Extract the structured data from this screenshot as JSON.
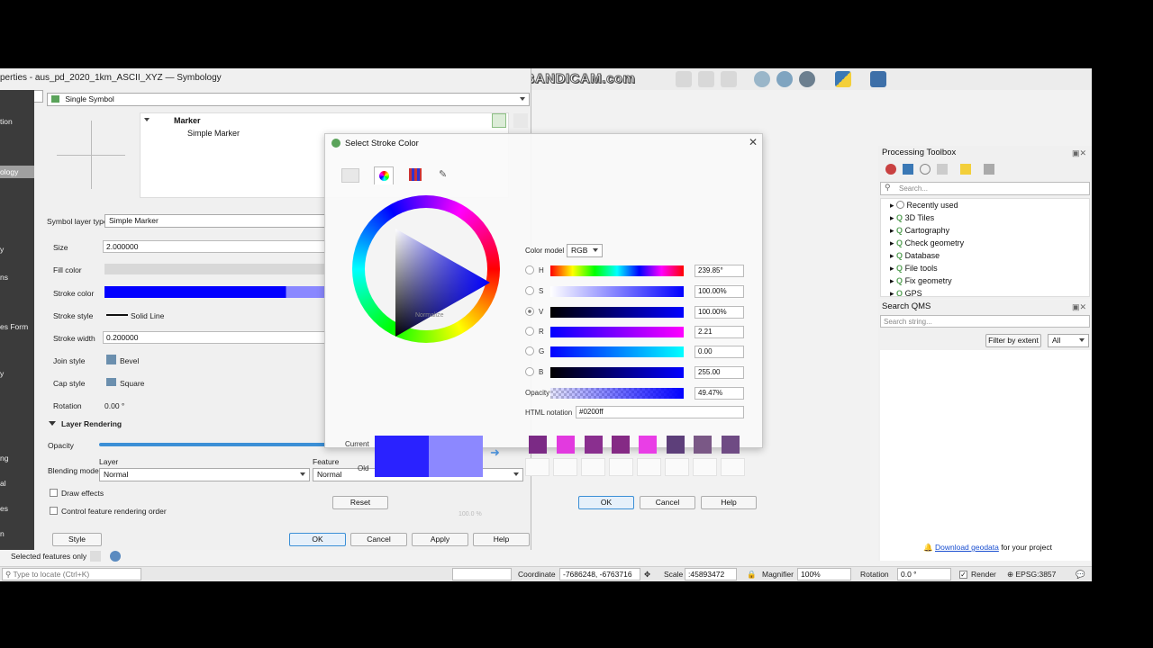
{
  "watermark": "www.BANDICAM.com",
  "props": {
    "title": "perties - aus_pd_2020_1km_ASCII_XYZ — Symbology",
    "nav": [
      "tion",
      "ology",
      "y",
      "ns",
      "es Form",
      "y",
      "ng",
      "al",
      "es",
      "n"
    ],
    "renderer": "Single Symbol",
    "tree": {
      "root": "Marker",
      "child": "Simple Marker"
    },
    "symbol_layer_type_label": "Symbol layer type",
    "symbol_layer_type": "Simple Marker",
    "size_label": "Size",
    "size": "2.000000",
    "fill_color_label": "Fill color",
    "stroke_color_label": "Stroke color",
    "stroke_style_label": "Stroke style",
    "stroke_style": "Solid Line",
    "stroke_width_label": "Stroke width",
    "stroke_width": "0.200000",
    "join_style_label": "Join style",
    "join_style": "Bevel",
    "cap_style_label": "Cap style",
    "cap_style": "Square",
    "rotation_label": "Rotation",
    "rotation": "0.00 °",
    "layer_rendering": "Layer Rendering",
    "opacity_label": "Opacity",
    "blending_label": "Blending mode",
    "layer_label": "Layer",
    "layer_mode": "Normal",
    "feature_label": "Feature",
    "feature_mode": "Normal",
    "draw_effects": "Draw effects",
    "control_order": "Control feature rendering order",
    "style_btn": "Style",
    "ok": "OK",
    "cancel": "Cancel",
    "apply": "Apply",
    "help": "Help",
    "selected_features": "Selected features only"
  },
  "color_dialog": {
    "title": "Select Stroke Color",
    "color_model_label": "Color model",
    "color_model": "RGB",
    "h_label": "H",
    "h": "239.85°",
    "s_label": "S",
    "s": "100.00%",
    "v_label": "V",
    "v": "100.00%",
    "r_label": "R",
    "r": "2.21",
    "g_label": "G",
    "g": "0.00",
    "b_label": "B",
    "b": "255.00",
    "opacity_label": "Opacity",
    "opacity": "49.47%",
    "html_label": "HTML notation",
    "html": "#0200ff",
    "current_label": "Current",
    "old_label": "Old",
    "current_color": "#0200ff",
    "swatches": [
      "#7b2a85",
      "#e23adf",
      "#8a2f8f",
      "#852a85",
      "#e93ee6",
      "#5d3f7a",
      "#7a5886",
      "#6f4b84"
    ],
    "reset": "Reset",
    "ok": "OK",
    "cancel": "Cancel",
    "help": "Help",
    "wheel_overlay": "Normalize",
    "faded_value": "100.0 %"
  },
  "toolbox": {
    "title": "Processing Toolbox",
    "search_placeholder": "Search...",
    "items": [
      "Recently used",
      "3D Tiles",
      "Cartography",
      "Check geometry",
      "Database",
      "File tools",
      "Fix geometry",
      "GPS"
    ]
  },
  "qms": {
    "title": "Search QMS",
    "search_placeholder": "Search string...",
    "filter_btn": "Filter by extent",
    "filter_value": "All",
    "download_link": "Download geodata",
    "download_text": "for your project"
  },
  "status": {
    "locate_placeholder": "Type to locate (Ctrl+K)",
    "coordinate_label": "Coordinate",
    "coordinate": "-7686248, -6763716",
    "scale_label": "Scale",
    "scale": ":45893472",
    "magnifier_label": "Magnifier",
    "magnifier": "100%",
    "rotation_label": "Rotation",
    "rotation": "0.0 °",
    "render_label": "Render",
    "crs": "EPSG:3857"
  }
}
